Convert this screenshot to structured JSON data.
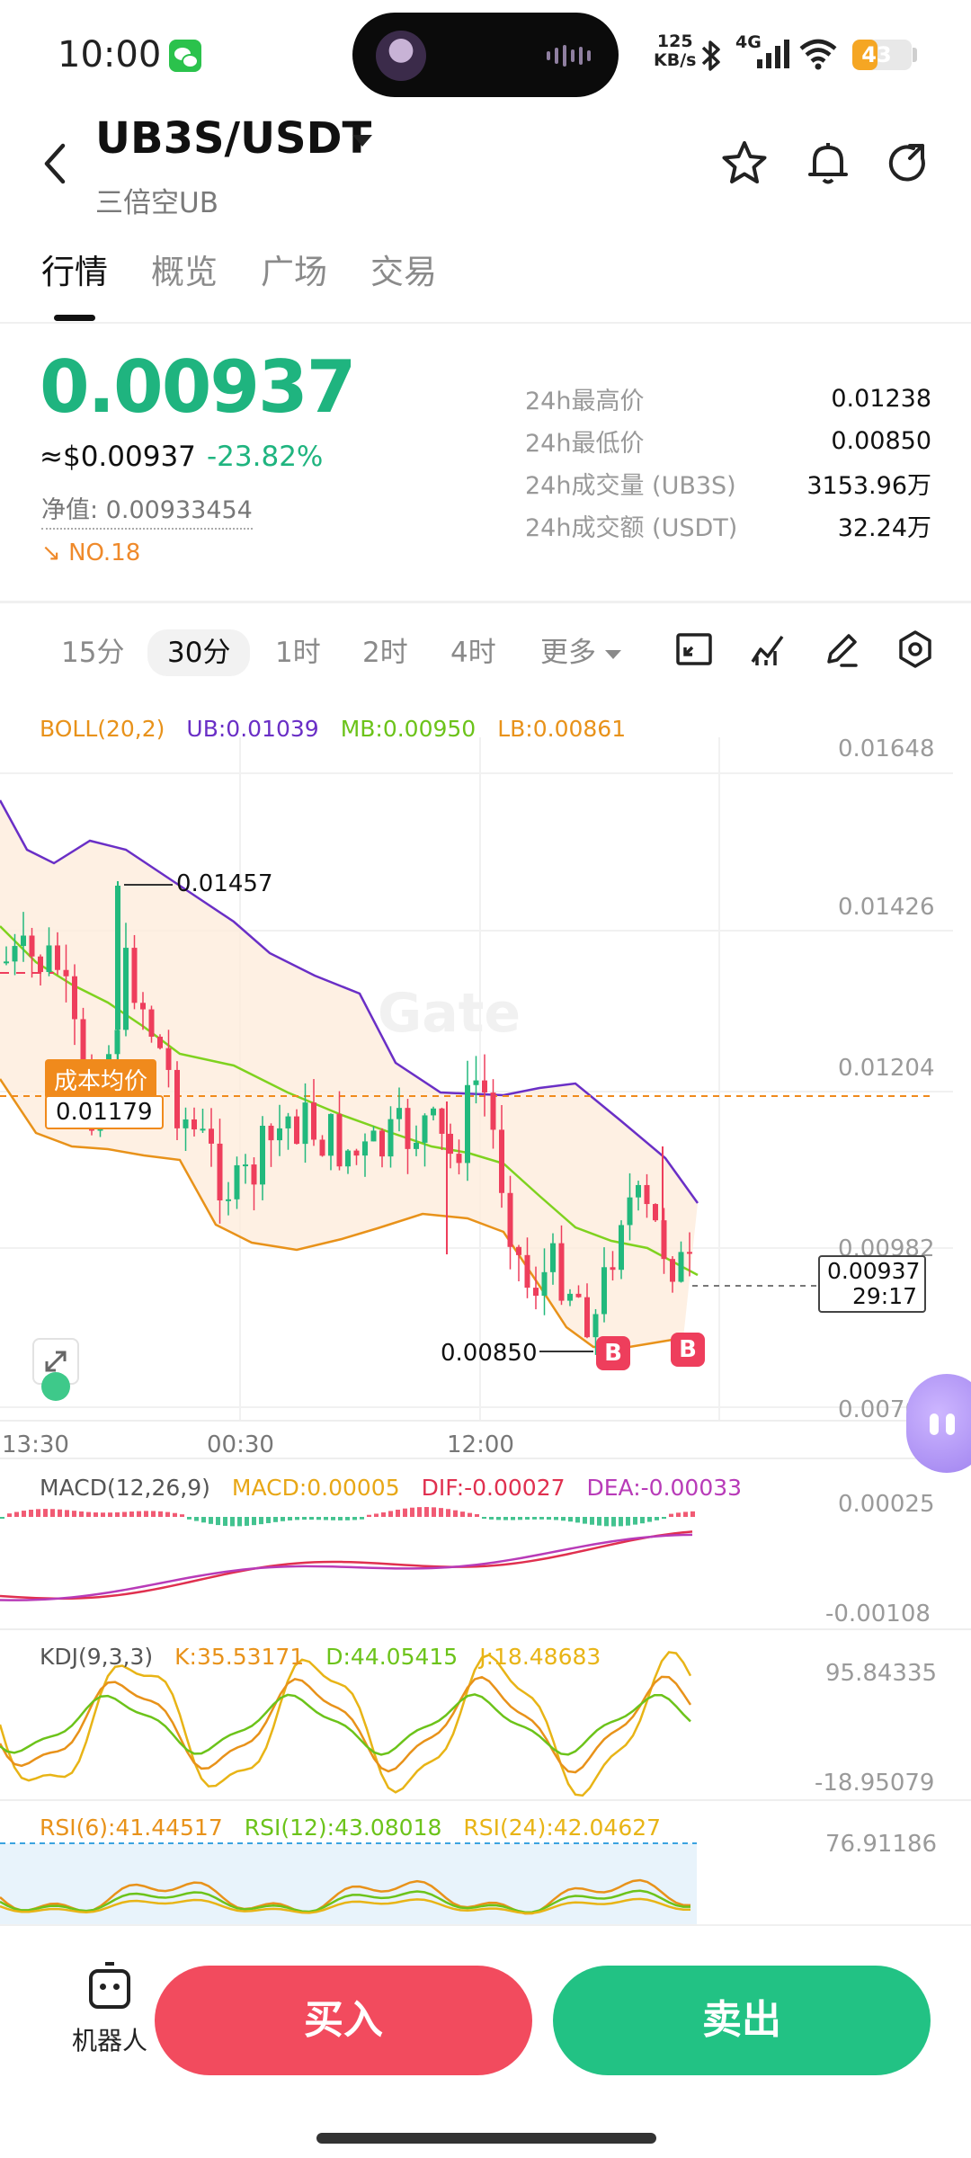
{
  "status_bar": {
    "time": "10:00",
    "net_speed_value": "125",
    "net_speed_unit": "KB/s",
    "network": "4G",
    "battery": "43",
    "battery_level": 0.43
  },
  "header": {
    "pair": "UB3S/USDT",
    "subtitle": "三倍空UB"
  },
  "tabs": [
    {
      "label": "行情"
    },
    {
      "label": "概览"
    },
    {
      "label": "广场"
    },
    {
      "label": "交易"
    }
  ],
  "price": {
    "last": "0.00937",
    "usd": "≈$0.00937",
    "change": "-23.82%",
    "nav": "净值: 0.00933454",
    "rank": "NO.18"
  },
  "stats": [
    {
      "label": "24h最高价",
      "value": "0.01238"
    },
    {
      "label": "24h最低价",
      "value": "0.00850"
    },
    {
      "label": "24h成交量 (UB3S)",
      "value": "3153.96万"
    },
    {
      "label": "24h成交额 (USDT)",
      "value": "32.24万"
    }
  ],
  "intervals": [
    {
      "label": "15分"
    },
    {
      "label": "30分"
    },
    {
      "label": "1时"
    },
    {
      "label": "2时"
    },
    {
      "label": "4时"
    },
    {
      "label": "更多"
    }
  ],
  "chart": {
    "boll": {
      "name": "BOLL(20,2)",
      "ub": "UB:0.01039",
      "mb": "MB:0.00950",
      "lb": "LB:0.00861"
    },
    "price_axis": [
      "0.01648",
      "0.01426",
      "0.01204",
      "0.00982",
      "0.00761"
    ],
    "time_axis": [
      "13:30",
      "00:30",
      "12:00"
    ],
    "watermark": "Gate",
    "high_marker": "0.01457",
    "low_marker": "0.00850",
    "cost_label": "成本均价",
    "cost_value": "0.01179",
    "last_price_tag": "0.00937",
    "countdown": "29:17",
    "buy_markers": [
      "B",
      "B"
    ],
    "macd": {
      "name": "MACD(12,26,9)",
      "macd": "MACD:0.00005",
      "dif": "DIF:-0.00027",
      "dea": "DEA:-0.00033",
      "axis_top": "0.00025",
      "axis_bottom": "-0.00108"
    },
    "kdj": {
      "name": "KDJ(9,3,3)",
      "k": "K:35.53171",
      "d": "D:44.05415",
      "j": "J:18.48683",
      "axis_top": "95.84335",
      "axis_bottom": "-18.95079"
    },
    "rsi": {
      "rsi6": "RSI(6):41.44517",
      "rsi12": "RSI(12):43.08018",
      "rsi24": "RSI(24):42.04627",
      "axis_top": "76.91186"
    },
    "colors": {
      "up": "#22b97d",
      "down": "#ee3e5c",
      "ub": "#6a2fc6",
      "mb": "#7fd21f",
      "lb": "#e8921a"
    }
  },
  "bottom": {
    "robot": "机器人",
    "buy": "买入",
    "sell": "卖出"
  }
}
